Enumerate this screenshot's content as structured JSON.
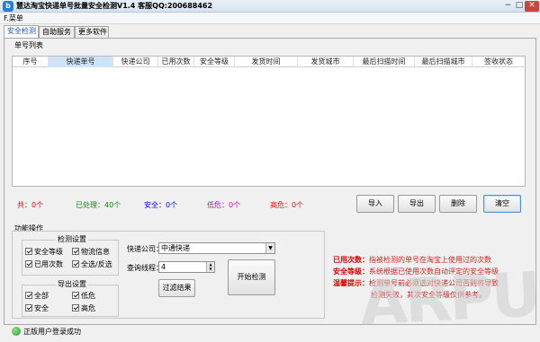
{
  "window": {
    "title": "慧达淘宝快递单号批量安全检测V1.4 客服QQ:200688462",
    "icon": "app-icon-b",
    "min": "−",
    "max": "□",
    "close": "✕"
  },
  "menu": {
    "file": "F.菜单"
  },
  "tabs": [
    {
      "label": "安全检测",
      "active": true
    },
    {
      "label": "自助服务"
    },
    {
      "label": "更多软件"
    }
  ],
  "list": {
    "caption": "单号列表",
    "columns": [
      "序号",
      "快递单号",
      "快递公司",
      "已用次数",
      "安全等级",
      "发货时间",
      "发货城市",
      "最后扫描时间",
      "最后扫描城市",
      "签收状态"
    ],
    "rows": []
  },
  "stats": {
    "total": "共：0个",
    "processed": "已处理：40个",
    "safe": "安全：0个",
    "low": "低危：0个",
    "high": "高危：0个",
    "colors": {
      "total": "#ff0000",
      "processed": "#009000",
      "safe": "#0000ff",
      "low": "#cc00cc",
      "high": "#ff0000"
    }
  },
  "list_actions": {
    "import": "导入",
    "export": "导出",
    "delete": "删除",
    "clear": "清空"
  },
  "ops": {
    "section_title": "功能操作",
    "detect_settings": {
      "title": "检测设置",
      "items": [
        {
          "label": "安全等级",
          "checked": true
        },
        {
          "label": "物流信息",
          "checked": true
        },
        {
          "label": "已用次数",
          "checked": true
        },
        {
          "label": "全选/反选",
          "checked": true
        }
      ]
    },
    "export_settings": {
      "title": "导出设置",
      "items": [
        {
          "label": "全部",
          "checked": true
        },
        {
          "label": "低危",
          "checked": true
        },
        {
          "label": "安全",
          "checked": true
        },
        {
          "label": "高危",
          "checked": true
        }
      ]
    },
    "courier_label": "快递公司：",
    "courier_value": "中通快递",
    "threads_label": "查询线程：",
    "threads_value": "4",
    "filter_button": "过滤结果",
    "start_button": "开始检测"
  },
  "notes": [
    {
      "key": "已用次数：",
      "text": "指被检测的单号在淘宝上使用过的次数"
    },
    {
      "key": "安全等级：",
      "text": "系统根据已使用次数自动评定的安全等级"
    },
    {
      "key": "温馨提示：",
      "text": "检测单号前必须选对快递公司否则将导致"
    },
    {
      "key": "",
      "text": "检测失败，其次安全等级仅供参考。"
    }
  ],
  "status": {
    "text": "正版用户登录成功",
    "icon": "status-ok-icon"
  },
  "watermark": "ARPUN"
}
